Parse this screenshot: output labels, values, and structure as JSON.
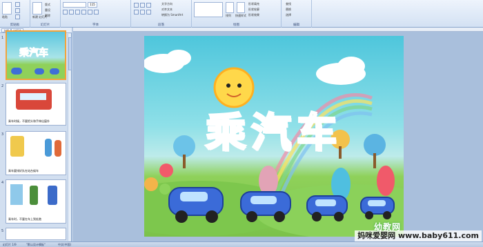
{
  "ribbon": {
    "groups": [
      "剪贴板",
      "幻灯片",
      "字体",
      "段落",
      "绘图",
      "编辑"
    ],
    "paste_label": "粘贴",
    "new_slide_label": "新建\n幻灯片",
    "layout_label": "版式",
    "reset_label": "重设",
    "delete_label": "删除",
    "font_size": "115",
    "arrange_label": "排列",
    "quick_styles_label": "快速样式",
    "find_label": "查找",
    "replace_label": "替换",
    "select_label": "选择",
    "text_direction_label": "文字方向",
    "align_text_label": "对齐文本",
    "smartart_label": "转换为 SmartArt",
    "shape_fill_label": "形状填充",
    "shape_outline_label": "形状轮廓",
    "shape_effects_label": "形状效果"
  },
  "panel": {
    "tab_outline": "大纲",
    "tab_slides": "幻灯片",
    "slides": [
      {
        "num": "1",
        "caption": "乘汽车"
      },
      {
        "num": "2",
        "caption": "乘车时候，不要把头和手伸出窗外"
      },
      {
        "num": "3",
        "caption": "乘车要排好队在站台候车"
      },
      {
        "num": "4",
        "caption": "乘车时，不要在车上到处跑"
      },
      {
        "num": "5",
        "caption": ""
      }
    ]
  },
  "slide": {
    "title": "乘汽车",
    "logo": "幼教网"
  },
  "status": {
    "slide_info": "幻灯片 1/9",
    "theme": "\"默认设计模板\"",
    "language": "中文(中国)"
  },
  "watermark": "妈咪爱婴网 www.baby611.com"
}
